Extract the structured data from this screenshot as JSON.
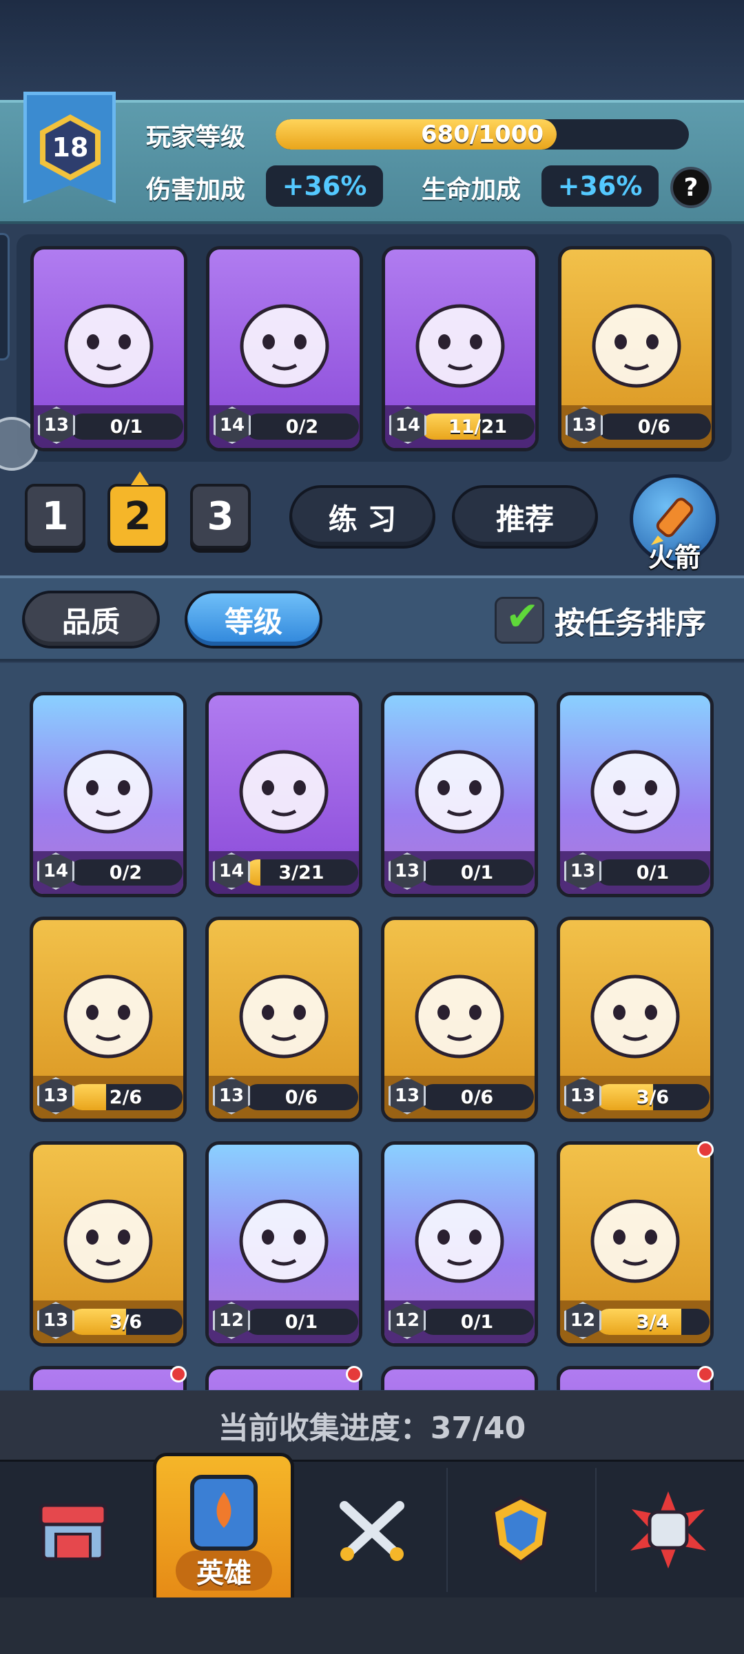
{
  "player": {
    "level": "18",
    "level_label": "玩家等级",
    "xp_text": "680/1000",
    "xp_progress": 0.68,
    "damage_label": "伤害加成",
    "damage_value": "+36%",
    "hp_label": "生命加成",
    "hp_value": "+36%",
    "help_label": "?"
  },
  "team": {
    "heroes": [
      {
        "name": "panda",
        "level": "13",
        "progress": "0/1",
        "fill": 0,
        "rarity": "purple"
      },
      {
        "name": "monkey-king",
        "level": "14",
        "progress": "0/2",
        "fill": 0,
        "rarity": "purple"
      },
      {
        "name": "zombie-brute",
        "level": "14",
        "progress": "11/21",
        "fill": 0.52,
        "rarity": "purple"
      },
      {
        "name": "white-cat",
        "level": "13",
        "progress": "0/6",
        "fill": 0,
        "rarity": "gold"
      }
    ],
    "slots": [
      "1",
      "2",
      "3"
    ],
    "active_slot": "2",
    "practice_label": "练 习",
    "recommend_label": "推荐",
    "rocket_label": "火箭"
  },
  "filters": {
    "quality_label": "品质",
    "level_label": "等级",
    "sort_label": "按任务排序",
    "sort_checked": true
  },
  "collection": {
    "heroes": [
      {
        "name": "jade-warrior",
        "level": "14",
        "progress": "0/2",
        "fill": 0,
        "rarity": "blue"
      },
      {
        "name": "yeti",
        "level": "14",
        "progress": "3/21",
        "fill": 0.14,
        "rarity": "purple"
      },
      {
        "name": "samurai",
        "level": "13",
        "progress": "0/1",
        "fill": 0,
        "rarity": "blue"
      },
      {
        "name": "pumpkin-gentleman",
        "level": "13",
        "progress": "0/1",
        "fill": 0,
        "rarity": "blue"
      },
      {
        "name": "rooster-boxer",
        "level": "13",
        "progress": "2/6",
        "fill": 0.33,
        "rarity": "gold"
      },
      {
        "name": "tribal-mask",
        "level": "13",
        "progress": "0/6",
        "fill": 0,
        "rarity": "gold"
      },
      {
        "name": "vampire-maid",
        "level": "13",
        "progress": "0/6",
        "fill": 0,
        "rarity": "gold"
      },
      {
        "name": "cloud-spirit",
        "level": "13",
        "progress": "3/6",
        "fill": 0.5,
        "rarity": "gold"
      },
      {
        "name": "feather-warrior",
        "level": "13",
        "progress": "3/6",
        "fill": 0.5,
        "rarity": "gold"
      },
      {
        "name": "frog-chef",
        "level": "12",
        "progress": "0/1",
        "fill": 0,
        "rarity": "blue"
      },
      {
        "name": "monk",
        "level": "12",
        "progress": "0/1",
        "fill": 0,
        "rarity": "blue"
      },
      {
        "name": "fox-mask-girl",
        "level": "12",
        "progress": "3/4",
        "fill": 0.75,
        "rarity": "gold"
      }
    ],
    "progress_text": "当前收集进度：37/40"
  },
  "nav": {
    "items": [
      {
        "name": "shop-icon"
      },
      {
        "name": "heroes-icon",
        "label": "英雄",
        "active": true
      },
      {
        "name": "battle-icon"
      },
      {
        "name": "clan-icon"
      },
      {
        "name": "gauntlet-icon"
      }
    ]
  },
  "colors": {
    "accent_gold": "#f5b629",
    "bonus_blue": "#54c9ff",
    "check_green": "#5fd83a"
  }
}
